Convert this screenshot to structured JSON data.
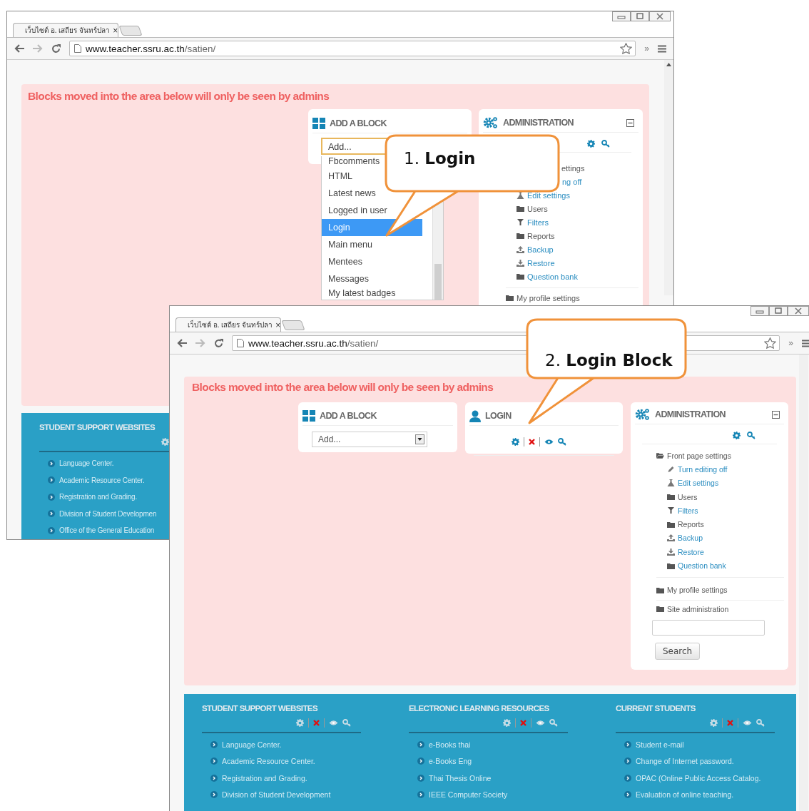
{
  "back_window": {
    "tab_title": "เว็บไซต์ อ. เสถียร จันทร์ปลา",
    "tab_close": "×",
    "url_host": "www.teacher.ssru.ac.th",
    "url_path": "/satien/",
    "overflow": "»",
    "admin_notice": "Blocks moved into the area below will only be seen by admins",
    "add_block": {
      "title": "ADD A BLOCK",
      "select_value": "Add...",
      "options": [
        {
          "label": "Fbcomments",
          "selected": false
        },
        {
          "label": "HTML",
          "selected": false
        },
        {
          "label": "Latest news",
          "selected": false
        },
        {
          "label": "Logged in user",
          "selected": false
        },
        {
          "label": "Login",
          "selected": true
        },
        {
          "label": "Main menu",
          "selected": false
        },
        {
          "label": "Mentees",
          "selected": false
        },
        {
          "label": "Messages",
          "selected": false
        },
        {
          "label": "My latest badges",
          "selected": false
        }
      ]
    },
    "admin": {
      "title": "ADMINISTRATION",
      "items": [
        {
          "label": "ettings",
          "link": false,
          "children": [
            {
              "label": "ng off",
              "link": true
            },
            {
              "label": "Edit settings",
              "kind": "flask",
              "link": true
            },
            {
              "label": "Users",
              "kind": "folder",
              "link": false
            },
            {
              "label": "Filters",
              "kind": "funnel",
              "link": true
            },
            {
              "label": "Reports",
              "kind": "folder",
              "link": false
            },
            {
              "label": "Backup",
              "kind": "upload",
              "link": true
            },
            {
              "label": "Restore",
              "kind": "download",
              "link": true
            },
            {
              "label": "Question bank",
              "kind": "folder",
              "link": true
            }
          ]
        },
        {
          "label": "My profile settings",
          "kind": "folder",
          "link": false
        }
      ]
    },
    "footer_block": {
      "title": "STUDENT SUPPORT WEBSITES",
      "links": [
        "Language Center.",
        "Academic Resource Center.",
        "Registration and Grading.",
        "Division of Student Developmen",
        "Office of the General Education"
      ]
    }
  },
  "front_window": {
    "tab_title": "เว็บไซต์ อ. เสถียร จันทร์ปลา",
    "tab_close": "×",
    "url_host": "www.teacher.ssru.ac.th",
    "url_path": "/satien/",
    "overflow": "»",
    "admin_notice": "Blocks moved into the area below will only be seen by admins",
    "add_block": {
      "title": "ADD A BLOCK",
      "select_value": "Add..."
    },
    "login_block": {
      "title": "LOGIN"
    },
    "admin": {
      "title": "ADMINISTRATION",
      "items": [
        {
          "label": "Front page settings",
          "kind": "folder-open",
          "link": false,
          "children": [
            {
              "label": "Turn editing off",
              "kind": "pencil",
              "link": true
            },
            {
              "label": "Edit settings",
              "kind": "flask",
              "link": true
            },
            {
              "label": "Users",
              "kind": "folder",
              "link": false
            },
            {
              "label": "Filters",
              "kind": "funnel",
              "link": true
            },
            {
              "label": "Reports",
              "kind": "folder",
              "link": false
            },
            {
              "label": "Backup",
              "kind": "upload",
              "link": true
            },
            {
              "label": "Restore",
              "kind": "download",
              "link": true
            },
            {
              "label": "Question bank",
              "kind": "folder",
              "link": true
            }
          ]
        },
        {
          "label": "My profile settings",
          "kind": "folder",
          "link": false
        },
        {
          "label": "Site administration",
          "kind": "folder",
          "link": false
        }
      ],
      "search_button": "Search"
    },
    "footer_blocks": [
      {
        "title": "STUDENT SUPPORT WEBSITES",
        "links": [
          "Language Center.",
          "Academic Resource Center.",
          "Registration and Grading.",
          "Division of Student Development"
        ]
      },
      {
        "title": "ELECTRONIC LEARNING RESOURCES",
        "links": [
          "e-Books thai",
          "e-Books Eng",
          "Thai Thesis Online",
          "IEEE Computer Society"
        ]
      },
      {
        "title": "CURRENT STUDENTS",
        "links": [
          "Student e-mail",
          "Change of Internet password.",
          "OPAC (Online Public Access Catalog.",
          "Evaluation of online teaching."
        ]
      }
    ]
  },
  "callouts": [
    {
      "text": "1. **Login**"
    },
    {
      "text": "2. **Login Block**"
    }
  ]
}
